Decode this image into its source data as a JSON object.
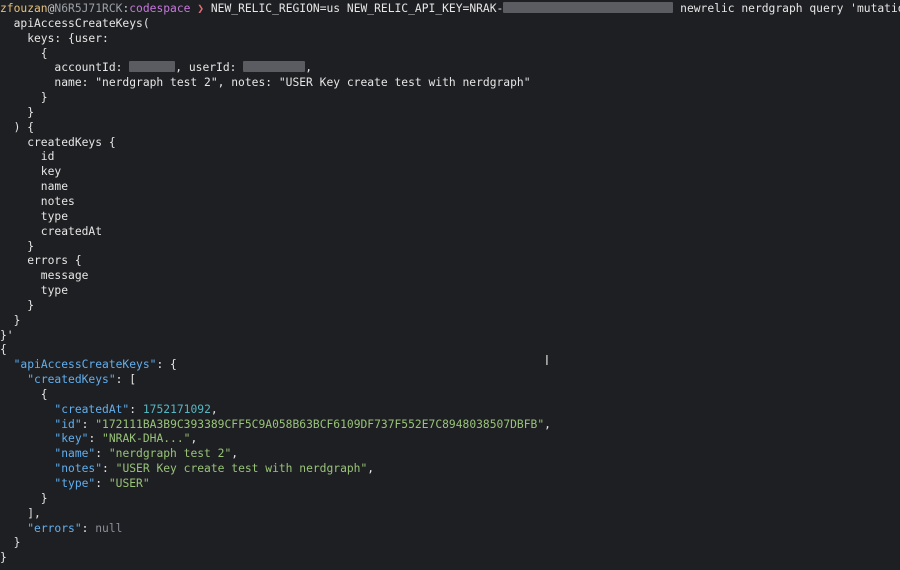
{
  "prompt": {
    "user": "zfouzan",
    "at": "@",
    "host": "N6R5J71RCK",
    "colon": ":",
    "path": "codespace",
    "arrow": " ❯ ",
    "command_prefix": "NEW_RELIC_REGION=us NEW_RELIC_API_KEY=NRAK-",
    "command_suffix": " newrelic nerdgraph query 'mutation {"
  },
  "query_lines": [
    "  apiAccessCreateKeys(",
    "    keys: {user:",
    "      {",
    "        accountId: ",
    ", userId: ",
    ",",
    "        name: \"nerdgraph test 2\", notes: \"USER Key create test with nerdgraph\"",
    "      }",
    "    }",
    "  ) {",
    "    createdKeys {",
    "      id",
    "      key",
    "      name",
    "      notes",
    "      type",
    "      createdAt",
    "    }",
    "    errors {",
    "      message",
    "      type",
    "    }",
    "  }",
    "}'"
  ],
  "response": {
    "root_open": "{",
    "root_key": "\"apiAccessCreateKeys\"",
    "created_keys_key": "\"createdKeys\"",
    "item": {
      "createdAt": {
        "key": "\"createdAt\"",
        "value": "1752171092"
      },
      "id": {
        "key": "\"id\"",
        "value": "\"172111BA3B9C393389CFF5C9A058B63BCF6109DF737F552E7C8948038507DBFB\""
      },
      "key": {
        "key": "\"key\"",
        "value": "\"NRAK-DHA...\""
      },
      "name": {
        "key": "\"name\"",
        "value": "\"nerdgraph test 2\""
      },
      "notes": {
        "key": "\"notes\"",
        "value": "\"USER Key create test with nerdgraph\""
      },
      "type": {
        "key": "\"type\"",
        "value": "\"USER\""
      }
    },
    "errors_key": "\"errors\"",
    "errors_value": "null"
  },
  "colors": {
    "background": "#1e1f22",
    "json_key": "#61afef",
    "json_string": "#98c379",
    "json_number": "#56b6c2",
    "prompt_user": "#e5c07b",
    "prompt_path": "#c678dd",
    "prompt_arrow": "#e06c75"
  }
}
